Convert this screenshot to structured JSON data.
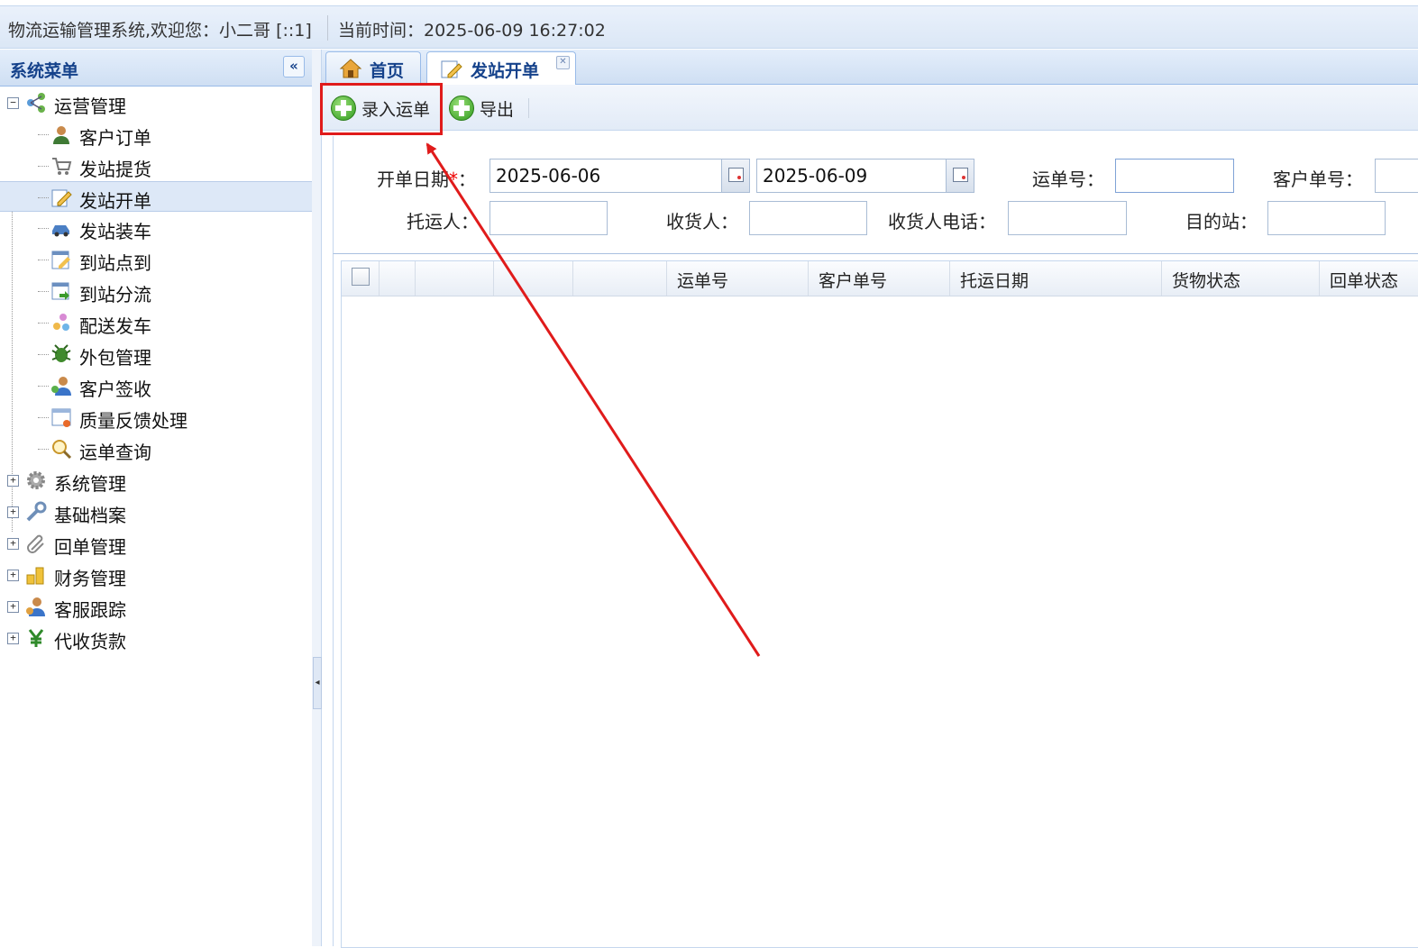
{
  "header": {
    "welcome": "物流运输管理系统,欢迎您：小二哥 [::1]",
    "time": "当前时间：2025-06-09 16:27:02"
  },
  "menu": {
    "title": "系统菜单",
    "collapse_glyph": "«",
    "root_ops": "运营管理",
    "items": [
      "客户订单",
      "发站提货",
      "发站开单",
      "发站装车",
      "到站点到",
      "到站分流",
      "配送发车",
      "外包管理",
      "客户签收",
      "质量反馈处理",
      "运单查询"
    ],
    "selected": "发站开单",
    "groups": [
      "系统管理",
      "基础档案",
      "回单管理",
      "财务管理",
      "客服跟踪",
      "代收货款"
    ]
  },
  "tabs": [
    {
      "label": "首页",
      "icon": "home-icon"
    },
    {
      "label": "发站开单",
      "icon": "edit-icon",
      "closable": true
    }
  ],
  "toolbar": {
    "add_label": "录入运单",
    "export_label": "导出"
  },
  "form": {
    "date_label": "开单日期",
    "required_mark": "*",
    "date_colon": "：",
    "date_from": "2025-06-06",
    "date_to": "2025-06-09",
    "waybill_label": "运单号：",
    "customer_no_label": "客户单号：",
    "shipper_label": "托运人：",
    "consignee_label": "收货人：",
    "consignee_phone_label": "收货人电话：",
    "destination_label": "目的站："
  },
  "grid": {
    "columns": [
      "运单号",
      "客户单号",
      "托运日期",
      "货物状态",
      "回单状态"
    ]
  },
  "colors": {
    "accent": "#15428b",
    "highlight": "#e01b1b"
  }
}
